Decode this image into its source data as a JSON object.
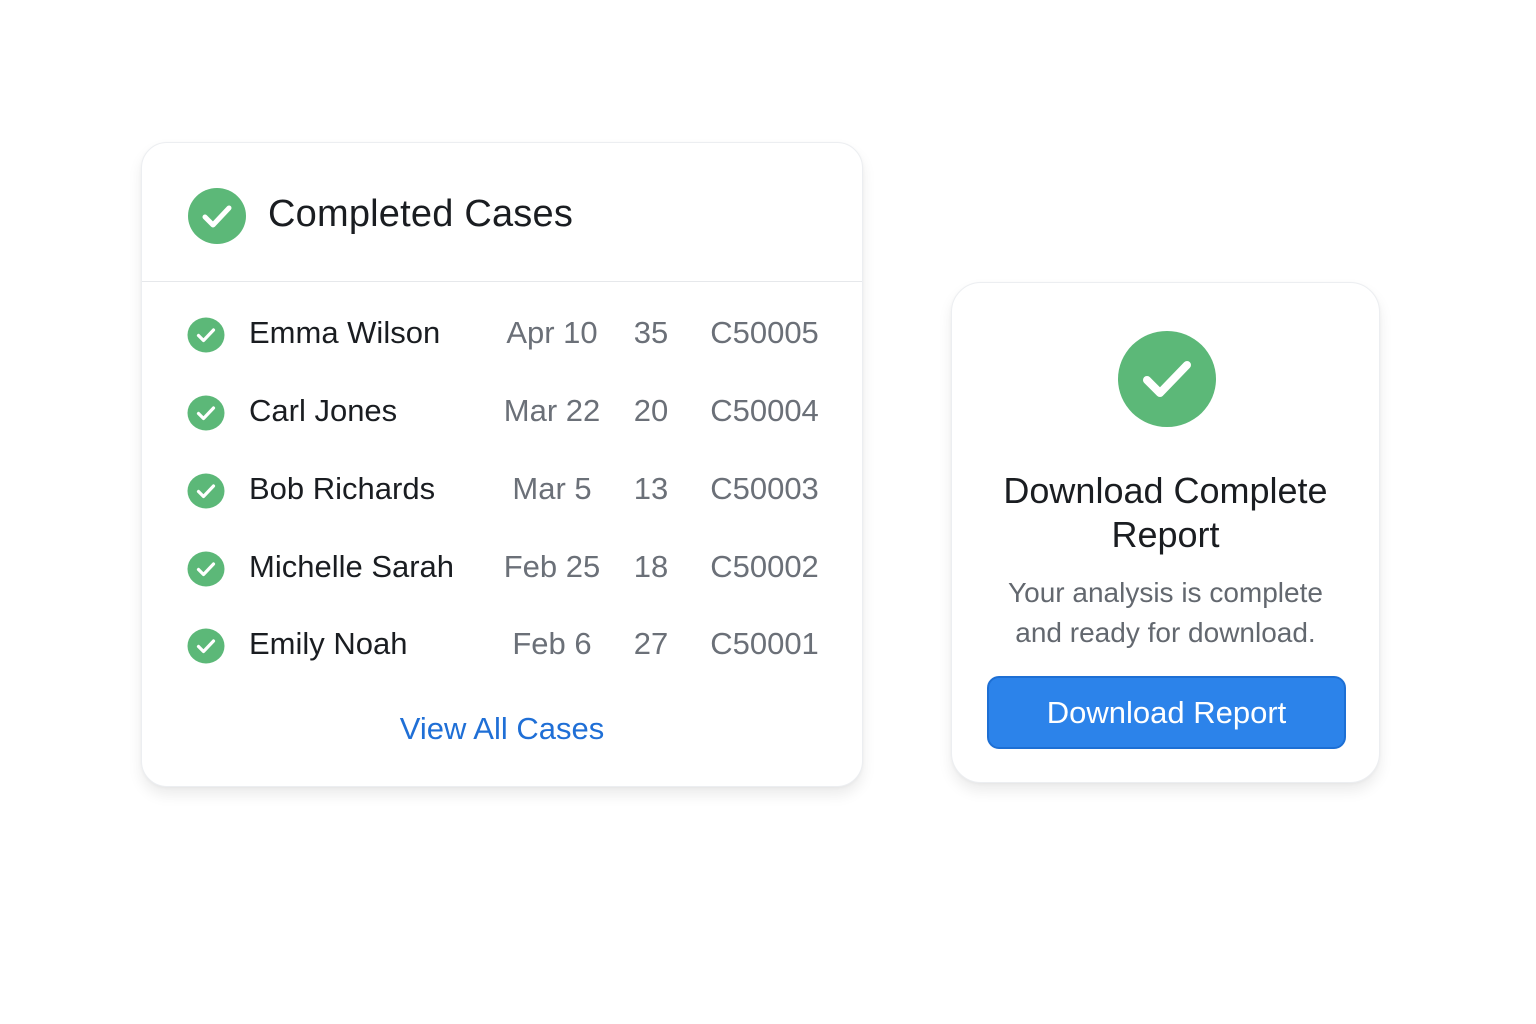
{
  "colors": {
    "success_green": "#5cb878",
    "link_blue": "#1f6fd6",
    "button_blue": "#2c83ea"
  },
  "icons": {
    "check": "check-circle-icon"
  },
  "cases_card": {
    "title": "Completed Cases",
    "rows": [
      {
        "name": "Emma Wilson",
        "date": "Apr 10",
        "count": "35",
        "case_id": "C50005"
      },
      {
        "name": "Carl Jones",
        "date": "Mar 22",
        "count": "20",
        "case_id": "C50004"
      },
      {
        "name": "Bob Richards",
        "date": "Mar 5",
        "count": "13",
        "case_id": "C50003"
      },
      {
        "name": "Michelle Sarah",
        "date": "Feb 25",
        "count": "18",
        "case_id": "C50002"
      },
      {
        "name": "Emily Noah",
        "date": "Feb 6",
        "count": "27",
        "case_id": "C50001"
      }
    ],
    "view_all_label": "View All Cases"
  },
  "download_card": {
    "title_line1": "Download Complete",
    "title_line2": "Report",
    "desc_line1": "Your analysis is complete",
    "desc_line2": "and ready for download.",
    "button_label": "Download Report"
  }
}
